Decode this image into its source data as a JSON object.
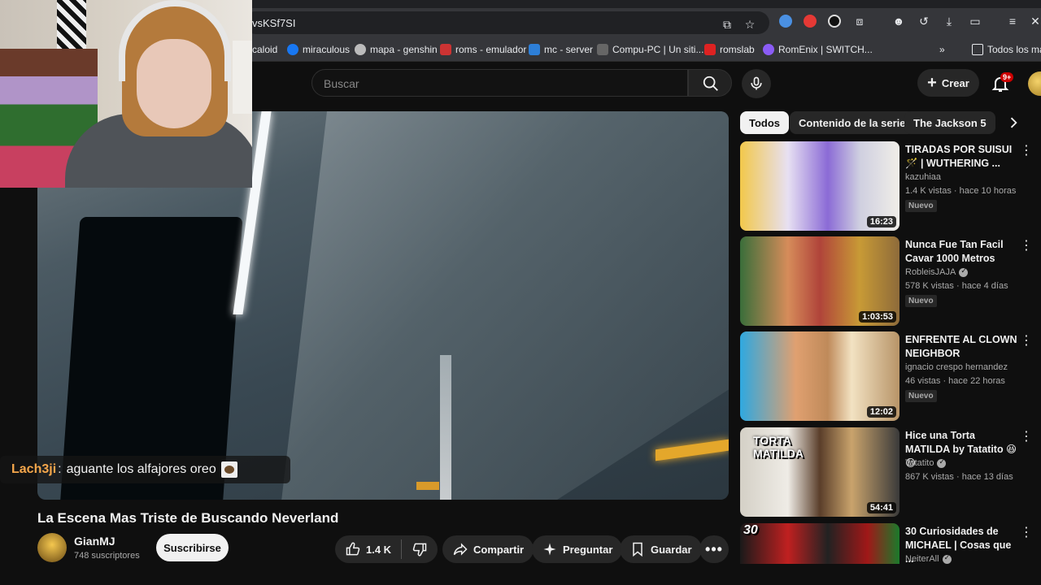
{
  "browser": {
    "url_text": "vsKSf7SI",
    "bookmarks": [
      {
        "label": "caloid",
        "color": "#444"
      },
      {
        "label": "miraculous",
        "color": "#1877f2"
      },
      {
        "label": "mapa - genshin",
        "color": "#999"
      },
      {
        "label": "roms - emulador",
        "color": "#c33"
      },
      {
        "label": "mc - server",
        "color": "#2d7fd8"
      },
      {
        "label": "Compu-PC | Un siti...",
        "color": "#666"
      },
      {
        "label": "romslab",
        "color": "#d22"
      },
      {
        "label": "RomEnix | SWITCH...",
        "color": "#8b5cf6"
      }
    ],
    "bookmarks_overflow": "»",
    "bookmarks_folder": "Todos los mar"
  },
  "header": {
    "search_placeholder": "Buscar",
    "create_label": "Crear",
    "notif_badge": "9+"
  },
  "chat": {
    "user": "Lach3ji",
    "separator": ":",
    "message": "aguante los alfajores oreo"
  },
  "video": {
    "title": "La Escena Mas Triste de Buscando Neverland",
    "channel": "GianMJ",
    "subscribers": "748 suscriptores",
    "subscribe_label": "Suscribirse",
    "likes": "1.4 K",
    "share_label": "Compartir",
    "ask_label": "Preguntar",
    "save_label": "Guardar"
  },
  "chips": [
    "Todos",
    "Contenido de la serie",
    "The Jackson 5"
  ],
  "recommendations": [
    {
      "title": "TIRADAS POR SUISUI 🪄 | WUTHERING ...",
      "channel": "kazuhiaa",
      "verified": false,
      "views": "1.4 K vistas · hace 10 horas",
      "badge": "Nuevo",
      "duration": "16:23"
    },
    {
      "title": "Nunca Fue Tan Facil Cavar 1000 Metros",
      "channel": "RobleisJAJA",
      "verified": true,
      "views": "578 K vistas · hace 4 días",
      "badge": "Nuevo",
      "duration": "1:03:53"
    },
    {
      "title": "ENFRENTE AL CLOWN NEIGHBOR",
      "channel": "ignacio crespo hernandez",
      "verified": false,
      "views": "46 vistas · hace 22 horas",
      "badge": "Nuevo",
      "duration": "12:02"
    },
    {
      "title": "Hice una Torta MATILDA by Tatatito 😆😆",
      "channel": "Tatatito",
      "verified": true,
      "views": "867 K vistas · hace 13 días",
      "badge": "",
      "duration": "54:41"
    },
    {
      "title": "30 Curiosidades de MICHAEL | Cosas que ...",
      "channel": "NeiterAll",
      "verified": true,
      "views": "",
      "badge": "",
      "duration": ""
    }
  ],
  "thumb_texts": {
    "torta": "TORTA",
    "matilda": "MATILDA",
    "thirty": "30"
  }
}
